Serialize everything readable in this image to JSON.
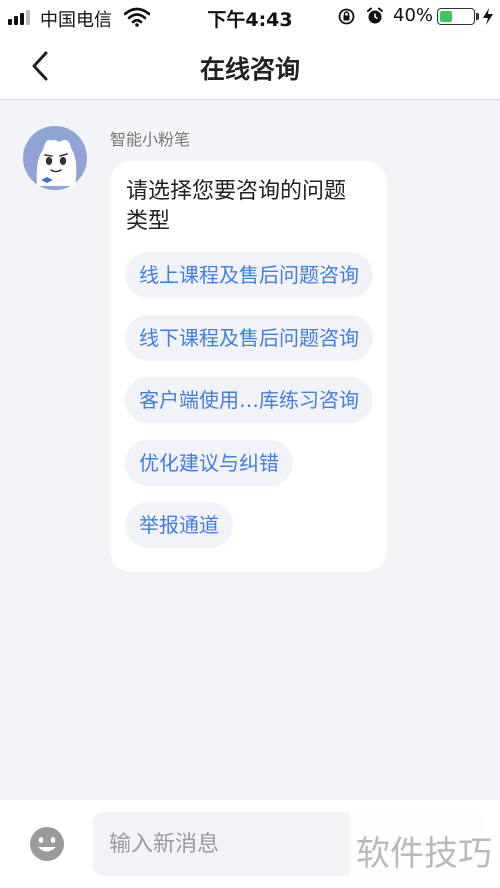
{
  "status_bar": {
    "carrier": "中国电信",
    "time": "下午4:43",
    "battery_percent_label": "40%",
    "battery_level": 0.4,
    "battery_color": "#38c95a",
    "icons": [
      "signal-icon",
      "wifi-icon",
      "orientation-lock-icon",
      "alarm-icon",
      "battery-icon",
      "charging-icon"
    ]
  },
  "nav": {
    "title": "在线咨询",
    "back_icon": "chevron-left-icon"
  },
  "chat": {
    "bot_name": "智能小粉笔",
    "question": "请选择您要咨询的问题类型",
    "options": [
      "线上课程及售后问题咨询",
      "线下课程及售后问题咨询",
      "客户端使用…库练习咨询",
      "优化建议与纠错",
      "举报通道"
    ]
  },
  "input_bar": {
    "placeholder": "输入新消息",
    "emoji_icon": "emoji-icon"
  },
  "watermark": "软件技巧",
  "colors": {
    "accent": "#3f7fe0",
    "background": "#f3f4f8",
    "option_background": "#f1f3f8"
  }
}
